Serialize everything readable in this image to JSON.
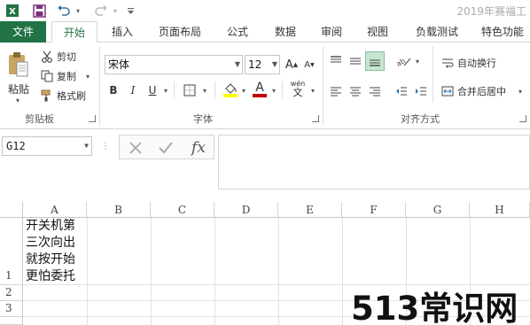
{
  "app": {
    "doc_title": "2019年赛福工",
    "accent_color": "#217346"
  },
  "quick_access": {
    "excel_icon": "excel-logo-icon",
    "save_icon": "save-icon",
    "undo_icon": "undo-icon",
    "redo_icon": "redo-icon",
    "customize_icon": "customize-qat-icon"
  },
  "tabs": [
    {
      "label": "文件"
    },
    {
      "label": "开始"
    },
    {
      "label": "插入"
    },
    {
      "label": "页面布局"
    },
    {
      "label": "公式"
    },
    {
      "label": "数据"
    },
    {
      "label": "审阅"
    },
    {
      "label": "视图"
    },
    {
      "label": "负载测试"
    },
    {
      "label": "特色功能"
    }
  ],
  "clipboard": {
    "paste_label": "粘贴",
    "cut_label": "剪切",
    "copy_label": "复制",
    "format_painter_label": "格式刷",
    "group_label": "剪贴板"
  },
  "font": {
    "name": "宋体",
    "size": "12",
    "bold": "B",
    "italic": "I",
    "underline": "U",
    "font_color": "A",
    "phonetic": "wén",
    "group_label": "字体"
  },
  "alignment": {
    "wrap_text_label": "自动换行",
    "merge_center_label": "合并后居中",
    "group_label": "对齐方式"
  },
  "formula_bar": {
    "name_box": "G12",
    "fx": "fx",
    "value": ""
  },
  "sheet": {
    "columns": [
      "A",
      "B",
      "C",
      "D",
      "E",
      "F",
      "G",
      "H"
    ],
    "rows": [
      "1",
      "2",
      "3"
    ],
    "cell_A1": "开关机第\n三次向出\n就按开始\n更怕委托"
  },
  "watermark": "513常识网"
}
